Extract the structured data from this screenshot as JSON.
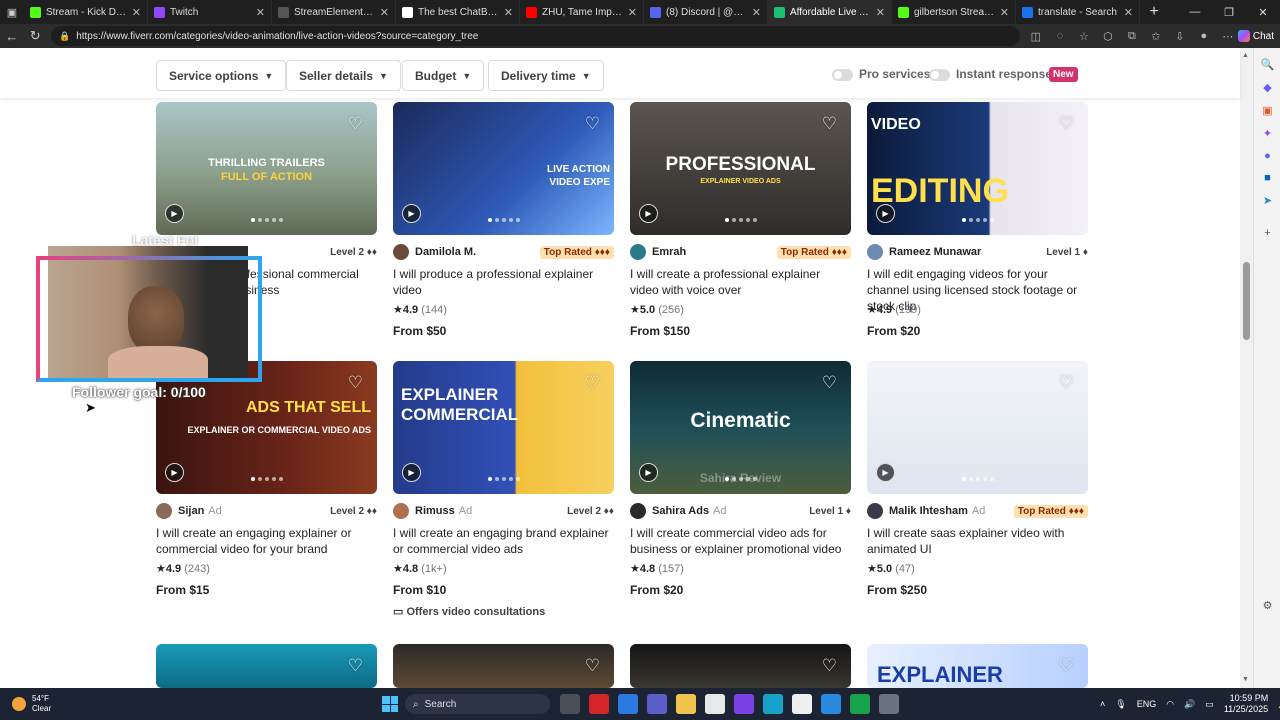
{
  "browser": {
    "tabs": [
      {
        "title": "Stream - Kick Dashboa",
        "color": "#53fc18"
      },
      {
        "title": "Twitch",
        "color": "#9146ff"
      },
      {
        "title": "StreamElements - light",
        "color": "#555"
      },
      {
        "title": "The best ChatBot and V",
        "color": "#ffffff"
      },
      {
        "title": "ZHU, Tame Impala",
        "color": "#ff0000"
      },
      {
        "title": "(8) Discord | @Ajacent",
        "color": "#5865f2"
      },
      {
        "title": "Affordable Live Action",
        "color": "#1dbf73"
      },
      {
        "title": "gilbertson Stream - We",
        "color": "#53fc18"
      },
      {
        "title": "translate - Search",
        "color": "#1a73e8"
      }
    ],
    "url": "https://www.fiverr.com/categories/video-animation/live-action-videos?source=category_tree",
    "chat_label": "Chat"
  },
  "filters": {
    "service_options": "Service options",
    "seller_details": "Seller details",
    "budget": "Budget",
    "delivery_time": "Delivery time",
    "pro_services": "Pro services",
    "instant_response": "Instant response",
    "new_badge": "New"
  },
  "gigs": [
    {
      "seller": "",
      "ad": false,
      "level": "Level 2 ♦♦",
      "title": "I will create a professional commercial video for your business",
      "rating": "",
      "count": "",
      "price": "",
      "overlay": "THRILLING TRAILERS",
      "overlay2": "FULL OF ACTION"
    },
    {
      "seller": "Damilola M.",
      "ad": false,
      "level": "Top Rated ♦♦♦",
      "title": "I will produce a professional explainer video",
      "rating": "4.9",
      "count": "(144)",
      "price": "From $50",
      "overlay": "LIVE ACTION",
      "overlay2": "VIDEO EXPE"
    },
    {
      "seller": "Emrah",
      "ad": false,
      "level": "Top Rated ♦♦♦",
      "title": "I will create a professional explainer video with voice over",
      "rating": "5.0",
      "count": "(256)",
      "price": "From $150",
      "overlay": "PROFESSIONAL",
      "overlay2": "EXPLAINER VIDEO ADS"
    },
    {
      "seller": "Rameez Munawar",
      "ad": false,
      "level": "Level 1 ♦",
      "title": "I will edit engaging videos for your channel using licensed stock footage or stock clip",
      "rating": "4.9",
      "count": "(199)",
      "price": "From $20",
      "overlay": "VIDEO",
      "overlay2": "EDITING"
    },
    {
      "seller": "Sijan",
      "ad": true,
      "level": "Level 2 ♦♦",
      "title": "I will create an engaging explainer or commercial video for your brand",
      "rating": "4.9",
      "count": "(243)",
      "price": "From $15",
      "overlay": "ADS THAT SELL",
      "overlay2": "EXPLAINER OR COMMERCIAL VIDEO ADS"
    },
    {
      "seller": "Rimuss",
      "ad": true,
      "level": "Level 2 ♦♦",
      "title": "I will create an engaging brand explainer or commercial video ads",
      "rating": "4.8",
      "count": "(1k+)",
      "price": "From $10",
      "overlay": "EXPLAINER",
      "overlay2": "COMMERCIAL",
      "consult": "Offers video consultations"
    },
    {
      "seller": "Sahira Ads",
      "ad": true,
      "level": "Level 1 ♦",
      "title": "I will create commercial video ads for business or explainer promotional video",
      "rating": "4.8",
      "count": "(157)",
      "price": "From $20",
      "overlay": "Cinematic",
      "overlay2": "Sahira Review"
    },
    {
      "seller": "Malik Ihtesham",
      "ad": true,
      "level": "Top Rated ♦♦♦",
      "title": "I will create saas explainer video with animated UI",
      "rating": "5.0",
      "count": "(47)",
      "price": "From $250",
      "overlay": "",
      "overlay2": ""
    }
  ],
  "ad_label": "Ad",
  "stream_overlay": {
    "latest": "Latest Fol",
    "goal": "Follower goal: 0/100"
  },
  "bottom_row": {
    "last_overlay": "EXPLAINER"
  },
  "taskbar": {
    "temp": "54°F",
    "condition": "Clear",
    "search": "Search",
    "lang": "ENG",
    "time": "10:59 PM",
    "date": "11/25/2025"
  }
}
